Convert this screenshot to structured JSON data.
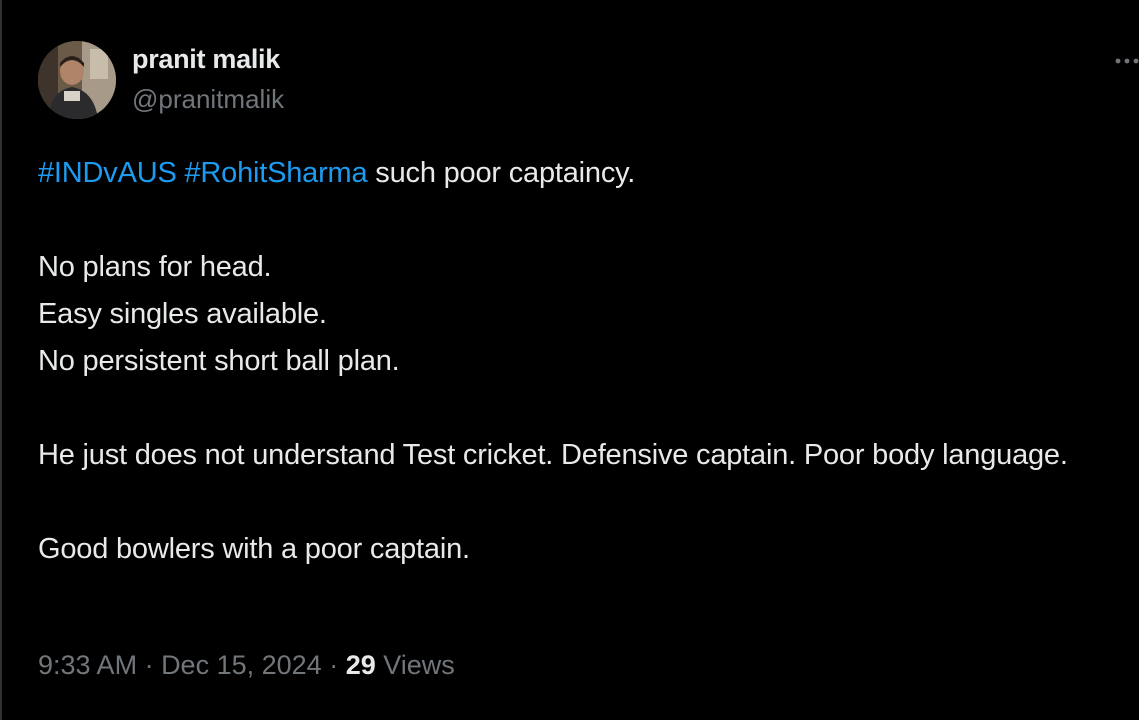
{
  "author": {
    "display_name": "pranit malik",
    "handle": "@pranitmalik"
  },
  "tweet": {
    "hashtags": [
      "#INDvAUS",
      "#RohitSharma"
    ],
    "first_line_rest": " such poor captaincy.",
    "lines_block2": [
      "No plans for head.",
      "Easy singles available.",
      "No persistent short ball plan."
    ],
    "line_block3": "He just does not understand Test cricket. Defensive captain. Poor body language.",
    "line_block4": "Good bowlers with a poor captain."
  },
  "meta": {
    "time": "9:33 AM",
    "separator": " · ",
    "date": "Dec 15, 2024",
    "views_count": "29",
    "views_label": " Views"
  },
  "icons": {
    "more": "more-horizontal-icon"
  },
  "colors": {
    "background": "#000000",
    "text": "#e7e9ea",
    "secondary": "#71767b",
    "link": "#1d9bf0"
  }
}
